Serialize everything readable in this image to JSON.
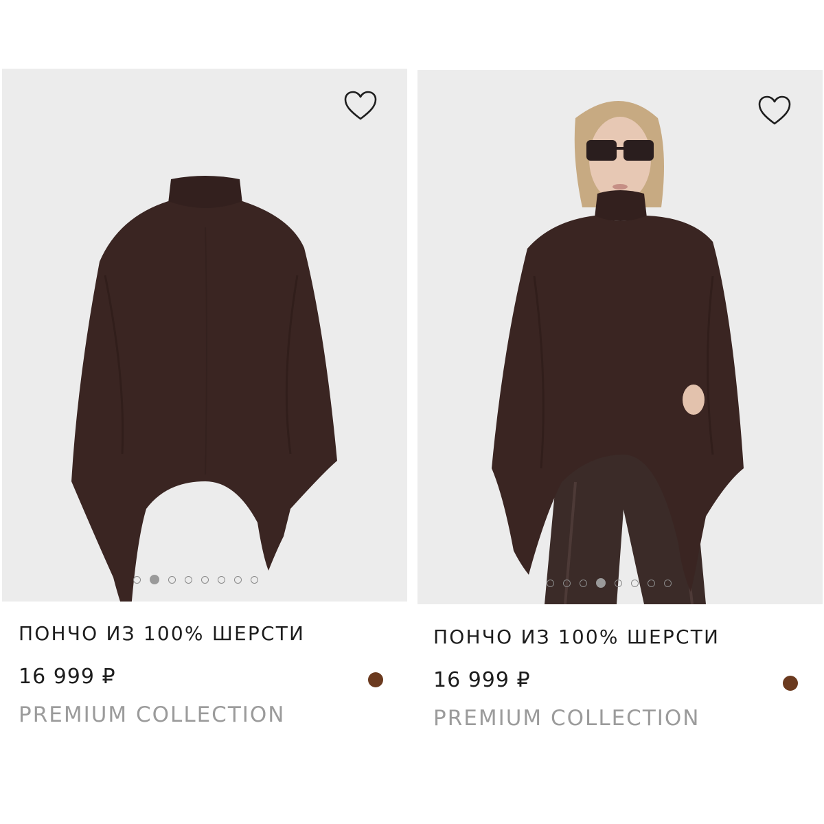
{
  "products": [
    {
      "title": "ПОНЧО ИЗ 100% ШЕРСТИ",
      "price": "16 999 ₽",
      "collection": "PREMIUM COLLECTION",
      "color_swatch": "#6b3a1f",
      "favorite_icon": "heart-outline-icon",
      "carousel": {
        "total": 8,
        "active_index": 1
      },
      "image_kind": "flat-lay product photo"
    },
    {
      "title": "ПОНЧО ИЗ 100% ШЕРСТИ",
      "price": "16 999 ₽",
      "collection": "PREMIUM COLLECTION",
      "color_swatch": "#6b3a1f",
      "favorite_icon": "heart-outline-icon",
      "carousel": {
        "total": 8,
        "active_index": 3
      },
      "image_kind": "model photo"
    }
  ],
  "colors": {
    "image_background": "#ededed",
    "garment": "#3a2522",
    "text_primary": "#1d1d1d",
    "text_muted": "#9b9b9b"
  }
}
